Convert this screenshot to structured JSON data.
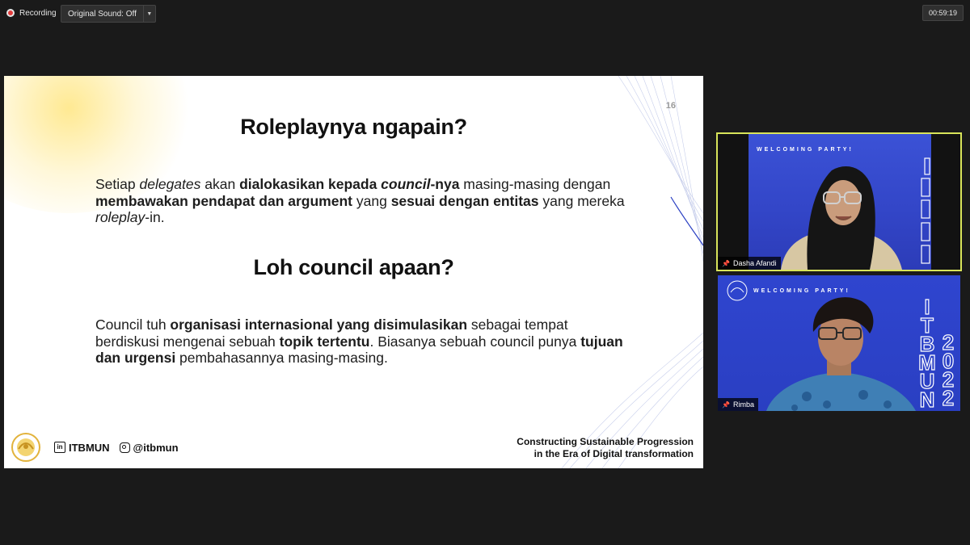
{
  "topbar": {
    "recording_label": "Recording",
    "sound_label": "Original Sound: Off",
    "timer": "00:59:19"
  },
  "slide": {
    "page_number": "16",
    "heading1": "Roleplaynya ngapain?",
    "para1": [
      {
        "t": "Setiap ",
        "s": "n"
      },
      {
        "t": "delegates",
        "s": "i"
      },
      {
        "t": " akan ",
        "s": "n"
      },
      {
        "t": "dialokasikan kepada ",
        "s": "b"
      },
      {
        "t": "council",
        "s": "bi"
      },
      {
        "t": "-nya",
        "s": "b"
      },
      {
        "t": " masing-masing dengan ",
        "s": "n"
      },
      {
        "t": "membawakan pendapat dan argument",
        "s": "b"
      },
      {
        "t": " yang ",
        "s": "n"
      },
      {
        "t": "sesuai dengan entitas",
        "s": "b"
      },
      {
        "t": " yang mereka ",
        "s": "n"
      },
      {
        "t": "roleplay",
        "s": "i"
      },
      {
        "t": "-in.",
        "s": "n"
      }
    ],
    "heading2": "Loh council apaan?",
    "para2": [
      {
        "t": "Council tuh ",
        "s": "n"
      },
      {
        "t": "organisasi internasional yang disimulasikan",
        "s": "b"
      },
      {
        "t": " sebagai tempat berdiskusi mengenai sebuah ",
        "s": "n"
      },
      {
        "t": "topik tertentu",
        "s": "b"
      },
      {
        "t": ". Biasanya sebuah council punya ",
        "s": "n"
      },
      {
        "t": "tujuan dan urgensi",
        "s": "b"
      },
      {
        "t": " pembahasannya masing-masing.",
        "s": "n"
      }
    ],
    "footer": {
      "linkedin": "ITBMUN",
      "instagram": "@itbmun",
      "tagline_line1": "Constructing Sustainable Progression",
      "tagline_line2": "in the Era of Digital transformation"
    }
  },
  "participants": [
    {
      "name": "Dasha Afandi",
      "banner": "WELCOMING PARTY!",
      "active": true
    },
    {
      "name": "Rimba",
      "banner": "WELCOMING PARTY!",
      "vertical_left": [
        "I",
        "T",
        "B",
        "M",
        "U",
        "N"
      ],
      "vertical_right": [
        "2",
        "0",
        "2",
        "2"
      ],
      "active": false
    }
  ],
  "colors": {
    "app_bg": "#1a1a1a",
    "active_speaker_border": "#d8e45a",
    "tile_blue": "#2f45cf"
  }
}
